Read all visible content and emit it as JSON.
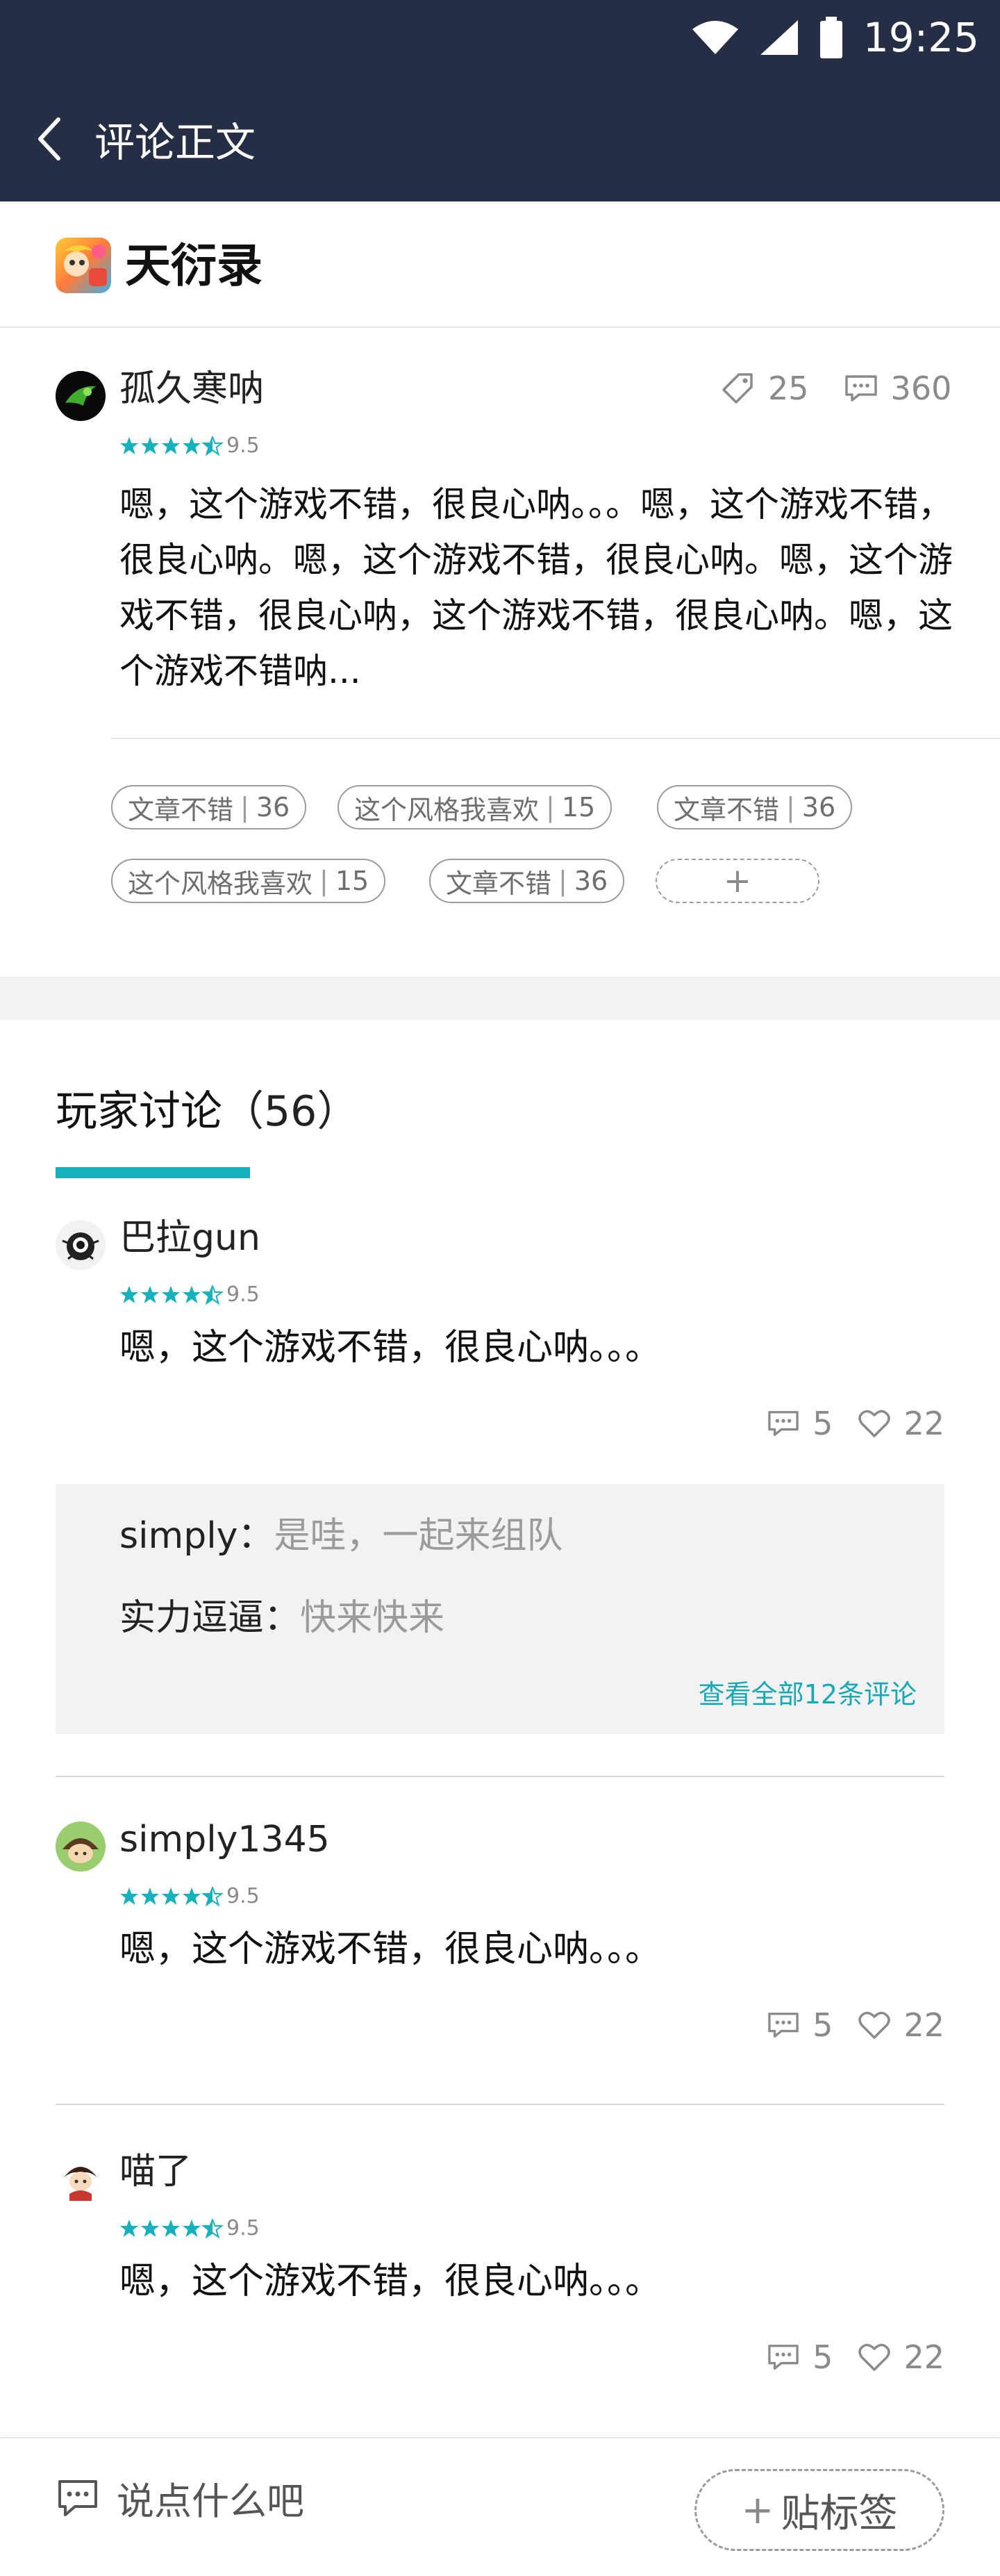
{
  "status_bar": {
    "time": "19:25"
  },
  "nav": {
    "title": "评论正文"
  },
  "game": {
    "title": "天衍录"
  },
  "review": {
    "author": "孤久寒呐",
    "rating": "9.5",
    "tag_count": "25",
    "comment_count": "360",
    "text": "嗯，这个游戏不错，很良心呐。。。嗯，这个游戏不错，很良心呐。嗯，这个游戏不错，很良心呐。嗯，这个游戏不错，很良心呐，这个游戏不错，很良心呐。嗯，这个游戏不错呐...",
    "tags": [
      {
        "label": "文章不错",
        "count": "36"
      },
      {
        "label": "这个风格我喜欢",
        "count": "15"
      },
      {
        "label": "文章不错",
        "count": "36"
      },
      {
        "label": "这个风格我喜欢",
        "count": "15"
      },
      {
        "label": "文章不错",
        "count": "36"
      }
    ],
    "add_tag_symbol": "+"
  },
  "discussion": {
    "title": "玩家讨论",
    "count": "（56）",
    "comments": [
      {
        "author": "巴拉gun",
        "rating": "9.5",
        "text": "嗯，这个游戏不错，很良心呐。。。",
        "reply_count": "5",
        "like_count": "22",
        "replies": [
          {
            "who": "simply：",
            "what": "是哇，一起来组队"
          },
          {
            "who": "实力逗逼：",
            "what": "快来快来"
          }
        ],
        "see_all": "查看全部12条评论"
      },
      {
        "author": "simply1345",
        "rating": "9.5",
        "text": "嗯，这个游戏不错，很良心呐。。。",
        "reply_count": "5",
        "like_count": "22"
      },
      {
        "author": "喵了",
        "rating": "9.5",
        "text": "嗯，这个游戏不错，很良心呐。。。",
        "reply_count": "5",
        "like_count": "22"
      }
    ]
  },
  "bottom_bar": {
    "input_placeholder": "说点什么吧",
    "add_tag_label": "贴标签",
    "add_tag_symbol": "+"
  },
  "colors": {
    "header": "#252e45",
    "accent": "#17b1bd",
    "star": "#17b1bd"
  },
  "icons": [
    "wifi-icon",
    "signal-icon",
    "battery-icon",
    "back-icon",
    "tag-icon",
    "comment-icon",
    "heart-icon",
    "chat-icon",
    "star-icon"
  ]
}
